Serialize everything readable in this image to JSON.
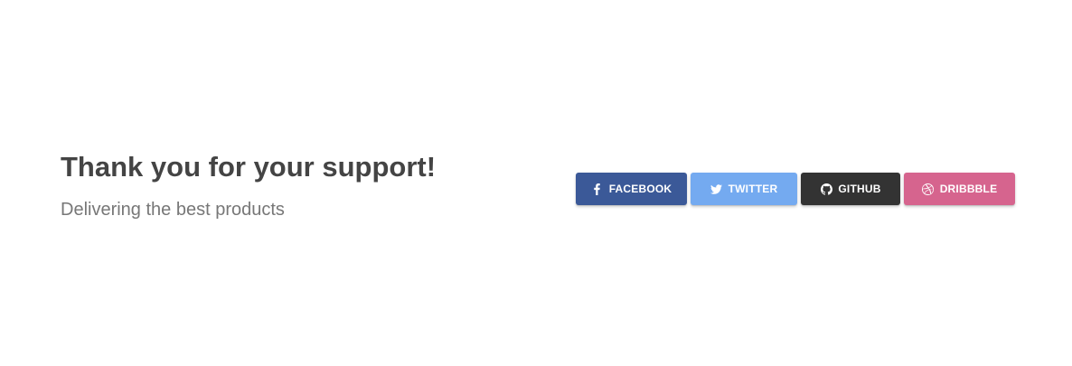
{
  "hero": {
    "title": "Thank you for your support!",
    "subtitle": "Delivering the best products"
  },
  "social": {
    "buttons": [
      {
        "label": "FACEBOOK",
        "icon": "facebook-icon",
        "color": "#3b5998"
      },
      {
        "label": "TWITTER",
        "icon": "twitter-icon",
        "color": "#74aaf0"
      },
      {
        "label": "GITHUB",
        "icon": "github-icon",
        "color": "#333333"
      },
      {
        "label": "DRIBBBLE",
        "icon": "dribbble-icon",
        "color": "#d6648e"
      }
    ]
  }
}
